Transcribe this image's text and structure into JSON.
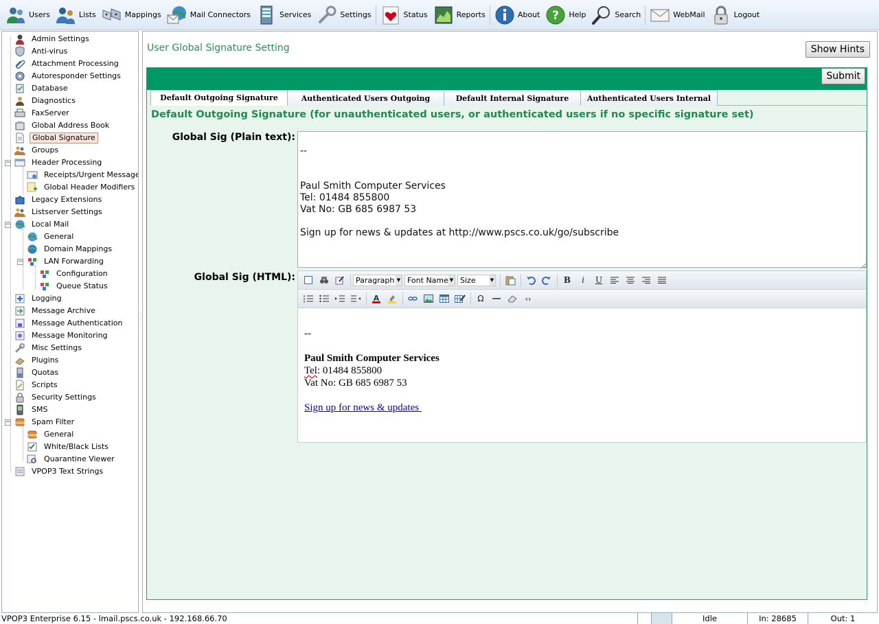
{
  "toolbar": {
    "items": [
      {
        "label": "Users",
        "icon": "users-icon"
      },
      {
        "label": "Lists",
        "icon": "lists-icon"
      },
      {
        "label": "Mappings",
        "icon": "mappings-icon"
      },
      {
        "label": "Mail Connectors",
        "icon": "mail-connectors-icon"
      },
      {
        "label": "Services",
        "icon": "services-icon"
      },
      {
        "label": "Settings",
        "icon": "settings-icon"
      },
      {
        "label": "Status",
        "icon": "status-icon"
      },
      {
        "label": "Reports",
        "icon": "reports-icon"
      },
      {
        "label": "About",
        "icon": "about-icon"
      },
      {
        "label": "Help",
        "icon": "help-icon"
      },
      {
        "label": "Search",
        "icon": "search-icon"
      },
      {
        "label": "WebMail",
        "icon": "webmail-icon"
      },
      {
        "label": "Logout",
        "icon": "logout-icon"
      }
    ]
  },
  "tree": {
    "items": [
      {
        "label": "Admin Settings"
      },
      {
        "label": "Anti-virus"
      },
      {
        "label": "Attachment Processing"
      },
      {
        "label": "Autoresponder Settings"
      },
      {
        "label": "Database"
      },
      {
        "label": "Diagnostics"
      },
      {
        "label": "FaxServer"
      },
      {
        "label": "Global Address Book"
      },
      {
        "label": "Global Signature"
      },
      {
        "label": "Groups"
      },
      {
        "label": "Header Processing"
      },
      {
        "label": "Receipts/Urgent Messages"
      },
      {
        "label": "Global Header Modifiers"
      },
      {
        "label": "Legacy Extensions"
      },
      {
        "label": "Listserver Settings"
      },
      {
        "label": "Local Mail"
      },
      {
        "label": "General"
      },
      {
        "label": "Domain Mappings"
      },
      {
        "label": "LAN Forwarding"
      },
      {
        "label": "Configuration"
      },
      {
        "label": "Queue Status"
      },
      {
        "label": "Logging"
      },
      {
        "label": "Message Archive"
      },
      {
        "label": "Message Authentication"
      },
      {
        "label": "Message Monitoring"
      },
      {
        "label": "Misc Settings"
      },
      {
        "label": "Plugins"
      },
      {
        "label": "Quotas"
      },
      {
        "label": "Scripts"
      },
      {
        "label": "Security Settings"
      },
      {
        "label": "SMS"
      },
      {
        "label": "Spam Filter"
      },
      {
        "label": "General"
      },
      {
        "label": "White/Black Lists"
      },
      {
        "label": "Quarantine Viewer"
      },
      {
        "label": "VPOP3 Text Strings"
      }
    ]
  },
  "main": {
    "title": "User Global Signature Setting",
    "show_hints": "Show Hints",
    "submit": "Submit",
    "tabs": [
      {
        "label": "Default Outgoing Signature"
      },
      {
        "label": "Authenticated Users Outgoing"
      },
      {
        "label": "Default Internal Signature"
      },
      {
        "label": "Authenticated Users Internal"
      }
    ],
    "section_heading": "Default Outgoing Signature (for unauthenticated users, or authenticated users if no specific signature set)",
    "plain_label": "Global Sig (Plain text):",
    "plain_value": "\n--\n\n\nPaul Smith Computer Services\nTel: 01484 855800\nVat No: GB 685 6987 53\n\nSign up for news & updates at http://www.pscs.co.uk/go/subscribe",
    "html_label": "Global Sig (HTML):",
    "editor": {
      "format_select": "Paragraph",
      "font_select": "Font Name",
      "size_select": "Size",
      "dash": "--",
      "company": "Paul Smith Computer Services",
      "tel_word": "Tel",
      "tel_rest": ": 01484 855800",
      "vat": "Vat No: GB 685 6987 53",
      "link_text": "Sign up for news & updates "
    }
  },
  "status": {
    "main": "VPOP3 Enterprise 6.15 - lmail.pscs.co.uk - 192.168.66.70",
    "state": "Idle",
    "in": "In: 28685",
    "out": "Out: 1"
  }
}
